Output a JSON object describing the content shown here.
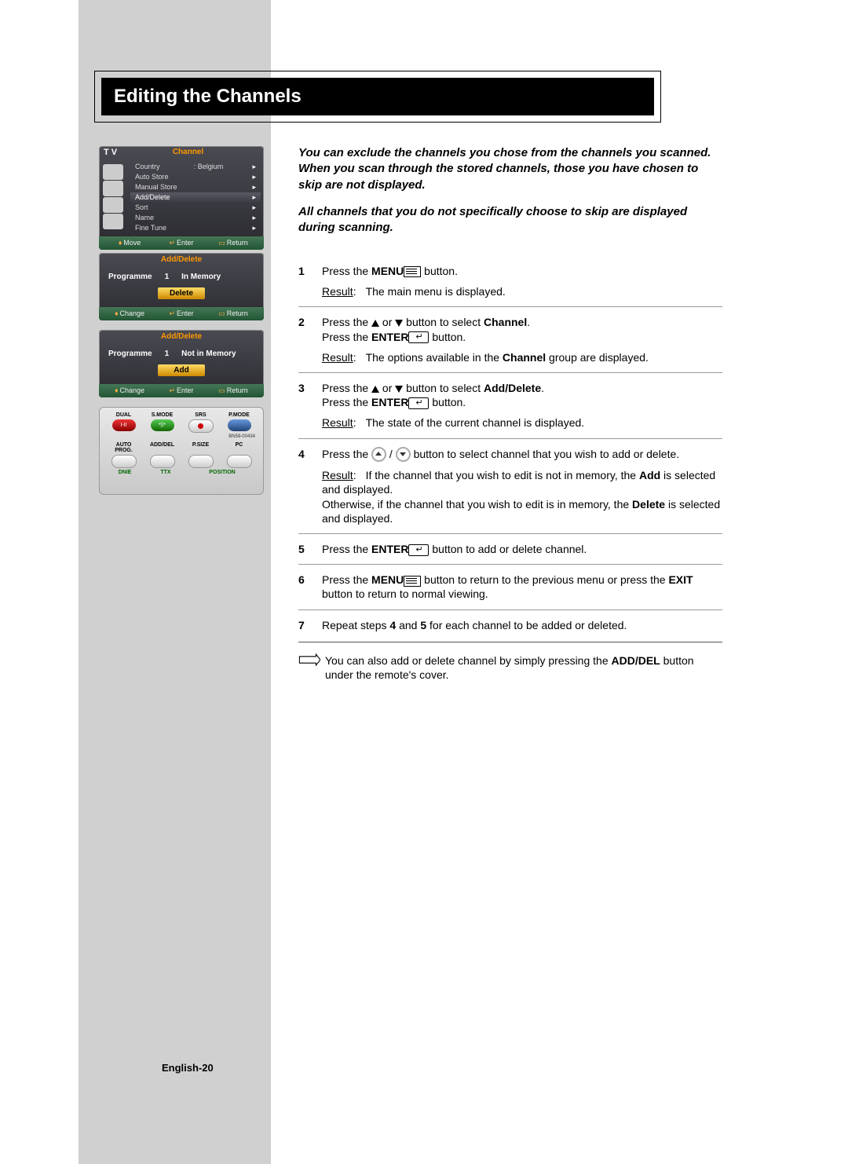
{
  "title": "Editing the Channels",
  "intro1": "You can exclude the channels you chose from the channels you scanned. When you scan through the stored channels, those you have chosen to skip are not displayed.",
  "intro2": "All channels that you do not specifically choose to skip are displayed during scanning.",
  "steps": {
    "s1a": "Press the ",
    "s1b": "MENU",
    "s1c": " button.",
    "s1r": "The main menu is displayed.",
    "s2a": "Press the ",
    "s2b": " or ",
    "s2c": " button to select ",
    "s2d": "Channel",
    "s2e": ".",
    "s2f": "Press the ",
    "s2g": "ENTER",
    "s2h": " button.",
    "s2r1": "The options available in the ",
    "s2r2": "Channel",
    "s2r3": " group are displayed.",
    "s3a": "Press the ",
    "s3b": " or ",
    "s3c": " button to select ",
    "s3d": "Add/Delete",
    "s3e": ".",
    "s3f": "Press the ",
    "s3g": "ENTER",
    "s3h": " button.",
    "s3r": "The state of the current channel is displayed.",
    "s4a": "Press the ",
    "s4b": " button to select channel that you wish to add or delete.",
    "s4r1": "If the channel that you wish to edit is not in memory, the ",
    "s4r2": "Add",
    "s4r3": " is selected and displayed.",
    "s4r4": "Otherwise, if the channel that you wish to edit is in memory, the ",
    "s4r5": "Delete",
    "s4r6": " is selected and displayed.",
    "s5a": "Press the ",
    "s5b": "ENTER",
    "s5c": " button to add or delete channel.",
    "s6a": "Press the ",
    "s6b": "MENU",
    "s6c": " button to return to the previous menu or press the ",
    "s6d": "EXIT",
    "s6e": " button to return to normal viewing.",
    "s7a": "Repeat steps ",
    "s7b": "4",
    "s7c": " and ",
    "s7d": "5",
    "s7e": " for each channel to be added or deleted."
  },
  "note1": "You can also add or delete channel by simply pressing the ",
  "note2": "ADD/DEL",
  "note3": " button under the remote's cover.",
  "result_label": "Result",
  "pagenum": "English-20",
  "osd": {
    "tv": "T V",
    "channel": "Channel",
    "country": "Country",
    "belgium": "Belgium",
    "autostore": "Auto Store",
    "manualstore": "Manual Store",
    "adddelete": "Add/Delete",
    "sort": "Sort",
    "name": "Name",
    "finetune": "Fine Tune",
    "move": "Move",
    "enter": "Enter",
    "return": "Return",
    "change": "Change",
    "programme": "Programme",
    "prognum": "1",
    "inmem": "In Memory",
    "notinmem": "Not in Memory",
    "delete": "Delete",
    "add": "Add"
  },
  "remote": {
    "dual": "DUAL",
    "smode": "S.MODE",
    "srs": "SRS",
    "pmode": "P.MODE",
    "iii": "I-II",
    "patent": "BN59-00434",
    "autoprog": "AUTO PROG.",
    "adddel": "ADD/DEL",
    "psize": "P.SIZE",
    "pc": "PC",
    "dnie": "DNIE",
    "ttx": "TTX",
    "position": "POSITION"
  }
}
